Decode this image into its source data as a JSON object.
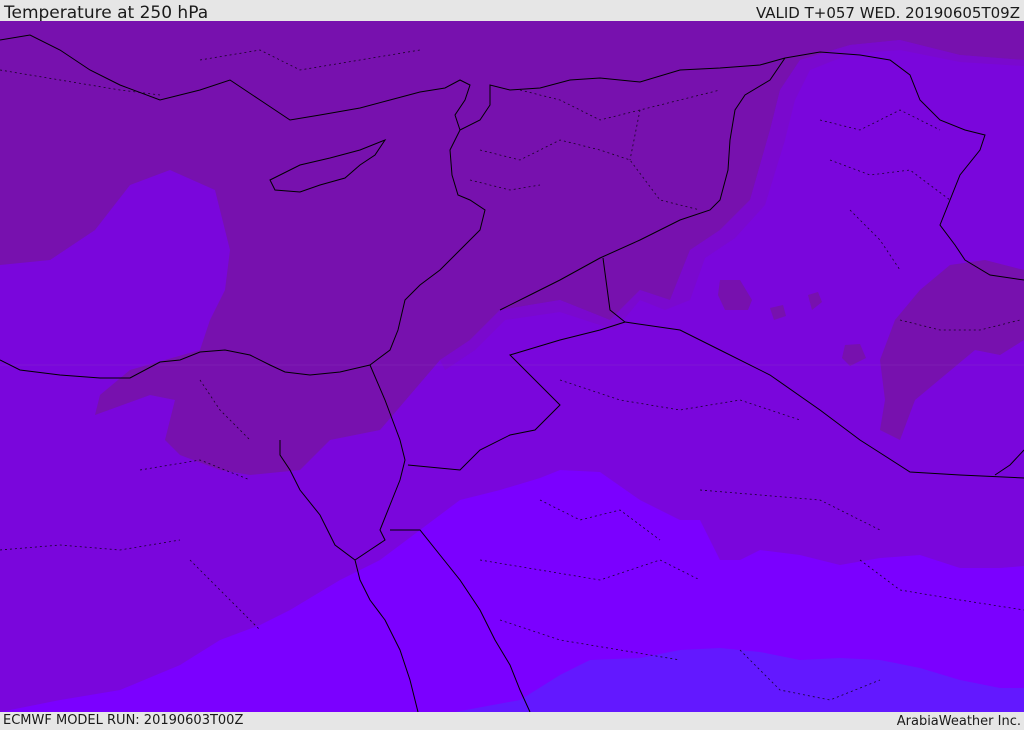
{
  "header": {
    "title": "Temperature at 250 hPa",
    "valid_time": "VALID T+057 WED. 20190605T09Z"
  },
  "footer": {
    "model_run": "ECMWF MODEL RUN: 20190603T00Z",
    "credit": "ArabiaWeather Inc."
  },
  "colors": {
    "warmest": "#7711ae",
    "warm": "#7a0cc8",
    "mid": "#7a06dc",
    "cool": "#7b00ff",
    "coolest": "#6318ff",
    "border": "#000000"
  }
}
